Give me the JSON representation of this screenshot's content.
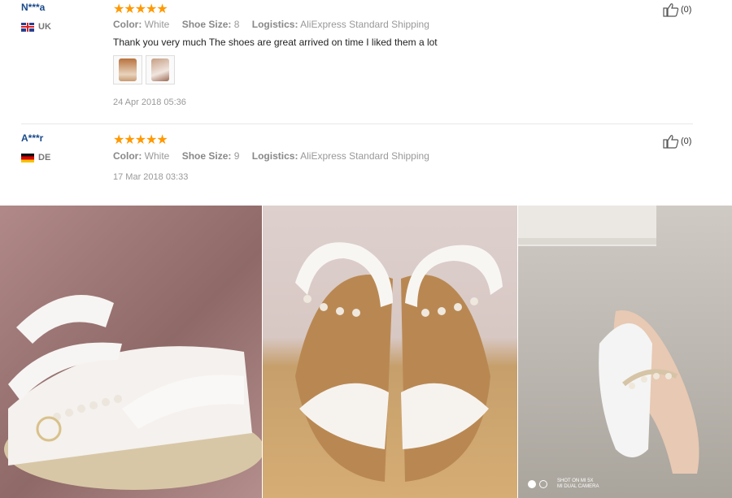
{
  "reviews": [
    {
      "user": "N***a",
      "country": "UK",
      "stars": "★★★★★",
      "color_label": "Color:",
      "color_value": "White",
      "size_label": "Shoe Size:",
      "size_value": "8",
      "logistics_label": "Logistics:",
      "logistics_value": "AliExpress Standard Shipping",
      "text": "Thank you very much The shoes are great arrived on time I liked them a lot",
      "date": "24 Apr 2018 05:36",
      "likes": "(0)"
    },
    {
      "user": "A***r",
      "country": "DE",
      "stars": "★★★★★",
      "color_label": "Color:",
      "color_value": "White",
      "size_label": "Shoe Size:",
      "size_value": "9",
      "logistics_label": "Logistics:",
      "logistics_value": "AliExpress Standard Shipping",
      "date": "17 Mar 2018 03:33",
      "likes": "(0)"
    }
  ],
  "camera_watermark": {
    "line1": "SHOT ON MI 5X",
    "line2": "MI DUAL CAMERA"
  },
  "icons": {
    "flag_uk": "uk-flag-icon",
    "flag_de": "germany-flag-icon",
    "thumbs_up": "thumbs-up-icon"
  },
  "colors": {
    "star": "#ff9900",
    "username": "#1a4a8a"
  }
}
